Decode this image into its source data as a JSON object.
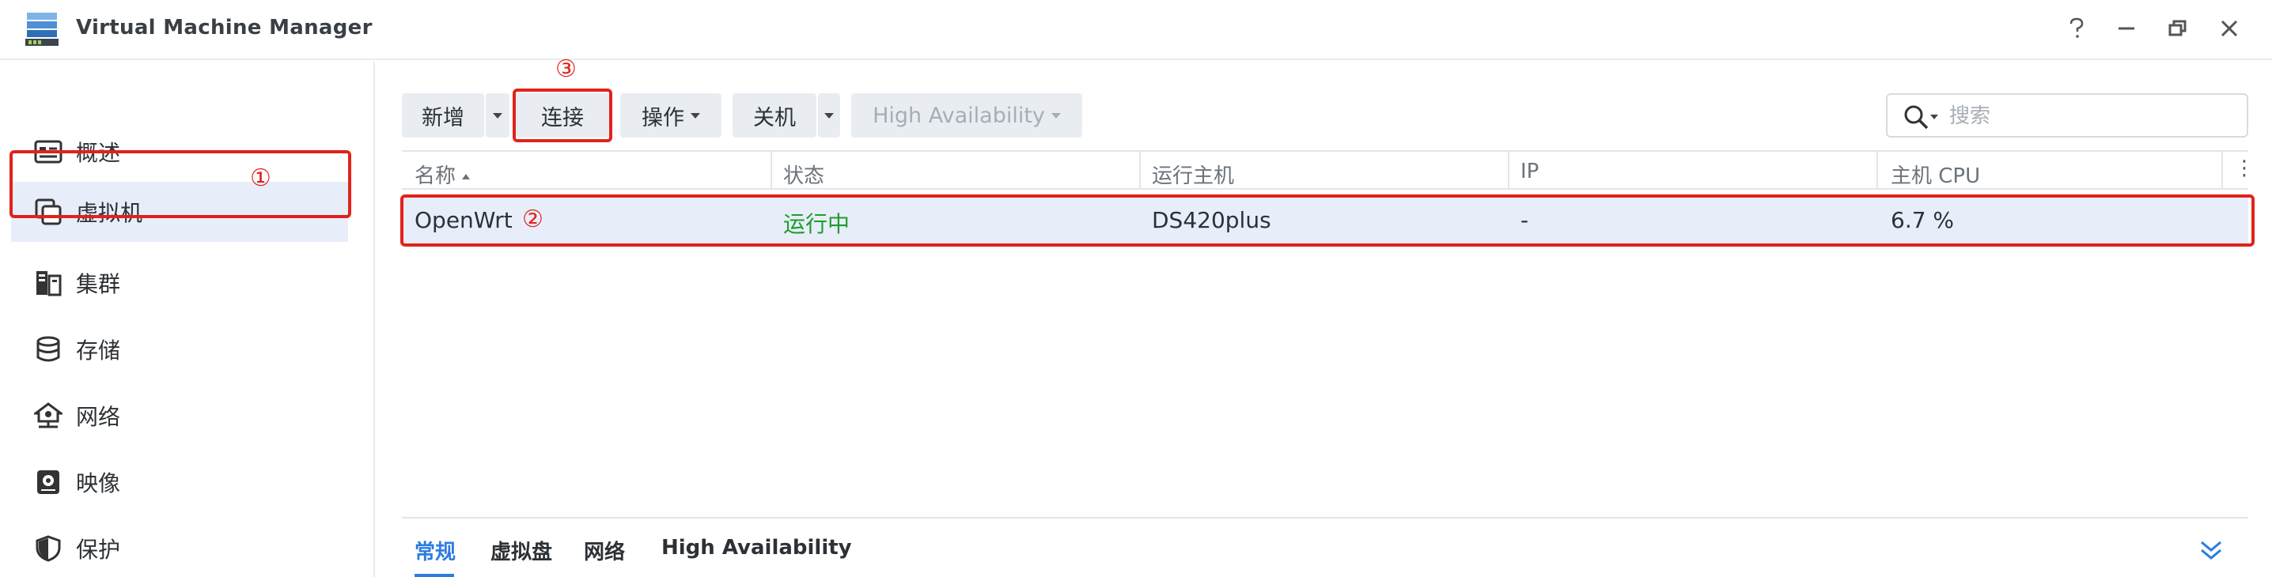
{
  "window": {
    "title": "Virtual Machine Manager",
    "controls": [
      "help-icon",
      "minimize-icon",
      "restore-icon",
      "close-icon"
    ]
  },
  "sidebar": {
    "items": [
      {
        "label": "概述",
        "icon": "overview-icon"
      },
      {
        "label": "虚拟机",
        "icon": "virtual-machine-icon",
        "active": true
      },
      {
        "label": "集群",
        "icon": "cluster-icon"
      },
      {
        "label": "存储",
        "icon": "storage-icon"
      },
      {
        "label": "网络",
        "icon": "network-icon"
      },
      {
        "label": "映像",
        "icon": "image-icon"
      },
      {
        "label": "保护",
        "icon": "shield-icon"
      }
    ]
  },
  "toolbar": {
    "new_label": "新增",
    "connect_label": "连接",
    "action_label": "操作",
    "shutdown_label": "关机",
    "ha_label": "High Availability"
  },
  "search": {
    "placeholder": "搜索"
  },
  "table": {
    "columns": [
      "名称",
      "状态",
      "运行主机",
      "IP",
      "主机 CPU"
    ],
    "rows": [
      {
        "name": "OpenWrt",
        "status": "运行中",
        "host": "DS420plus",
        "ip": "-",
        "cpu": "6.7 %"
      }
    ]
  },
  "detail_tabs": [
    "常规",
    "虚拟盘",
    "网络",
    "High Availability"
  ],
  "annotations": {
    "one": "①",
    "two": "②",
    "three": "③"
  },
  "colors": {
    "accent": "#2d7ce0",
    "running": "#1f9d2c",
    "highlight": "#e1221c",
    "selected_row": "#e7eefa"
  }
}
